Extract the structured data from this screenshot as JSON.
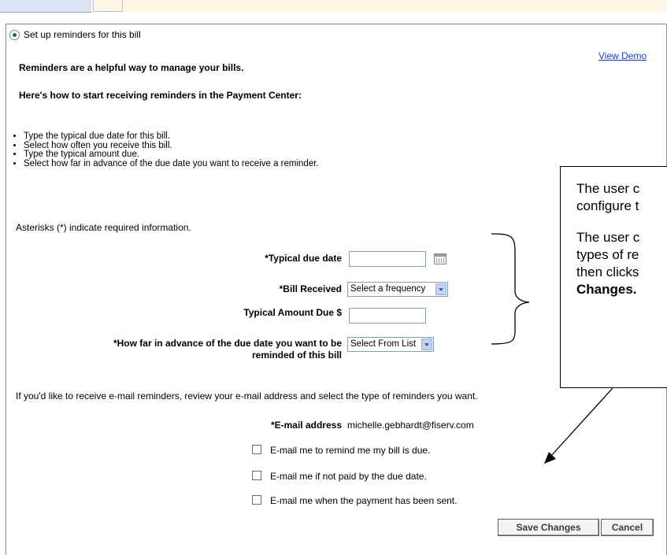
{
  "intro": {
    "radio_label": "Set up reminders for this bill",
    "view_demo": "View Demo",
    "heading1": "Reminders are a helpful way to manage your bills.",
    "heading2": "Here's how to start receiving reminders in the Payment Center:",
    "bullets": [
      "Type the typical due date for this bill.",
      "Select how often you receive this bill.",
      "Type the typical amount due.",
      "Select how far in advance of the due date you want to receive a reminder."
    ],
    "asterisk_note": "Asterisks (*) indicate required information."
  },
  "form": {
    "due_date_label": "*Typical due date",
    "bill_received_label": "*Bill Received",
    "bill_received_value": "Select a frequency",
    "amount_label": "Typical Amount Due $",
    "advance_label_line1": "*How far in advance of the due date you want to be",
    "advance_label_line2": "reminded of this bill",
    "advance_value": "Select From List"
  },
  "email": {
    "intro": "If you'd like to receive e-mail reminders, review your e-mail address and select the type of reminders you want.",
    "address_label": "*E-mail address",
    "address_value": "michelle.gebhardt@fiserv.com",
    "options": [
      "E-mail me to remind me my bill is due.",
      "E-mail me if not paid by the due date.",
      "E-mail me when the payment has been sent."
    ]
  },
  "buttons": {
    "save": "Save Changes",
    "cancel": "Cancel"
  },
  "callout": {
    "line1": "The user c",
    "line2": "configure t",
    "line3": "The user c",
    "line4": "types of re",
    "line5": "then clicks",
    "line6": "Changes."
  }
}
